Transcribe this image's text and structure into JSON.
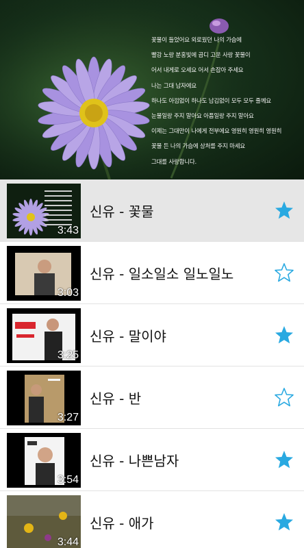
{
  "header": {
    "lyrics": [
      "꽃물이 들었어요 외로웠던 나의 가슴에",
      "빨강 노랑 분홍빛에 곱디 고운 사랑 꽃물이",
      "어서 내게로 오세요 어서 손잡아 주세요",
      "나는 그대 남자에요",
      "하나도 아낌없이 하나도 남김없이 모두 모두 줄께요",
      "눈물일랑 주지 말아요 아픔일랑 주지 말아요",
      "이제는 그대만이 나에게 전부에요 영원히 영원히 영원히",
      "꽃물 든 나의 가슴에 상처를 주지 마세요",
      "그대를 사랑합니다."
    ]
  },
  "colors": {
    "accent": "#29a9e1",
    "selected_bg": "#e6e6e6"
  },
  "tracks": [
    {
      "title": "신유 - 꽃물",
      "duration": "3:43",
      "favorite": true,
      "selected": true
    },
    {
      "title": "신유 - 일소일소 일노일노",
      "duration": "3:03",
      "favorite": false,
      "selected": false
    },
    {
      "title": "신유 - 말이야",
      "duration": "3:25",
      "favorite": true,
      "selected": false
    },
    {
      "title": "신유 - 반",
      "duration": "3:27",
      "favorite": false,
      "selected": false
    },
    {
      "title": "신유 - 나쁜남자",
      "duration": "3:54",
      "favorite": true,
      "selected": false
    },
    {
      "title": "신유 - 애가",
      "duration": "3:44",
      "favorite": true,
      "selected": false
    }
  ],
  "icons": {
    "favorite_on": "star-filled-icon",
    "favorite_off": "star-outline-icon"
  }
}
